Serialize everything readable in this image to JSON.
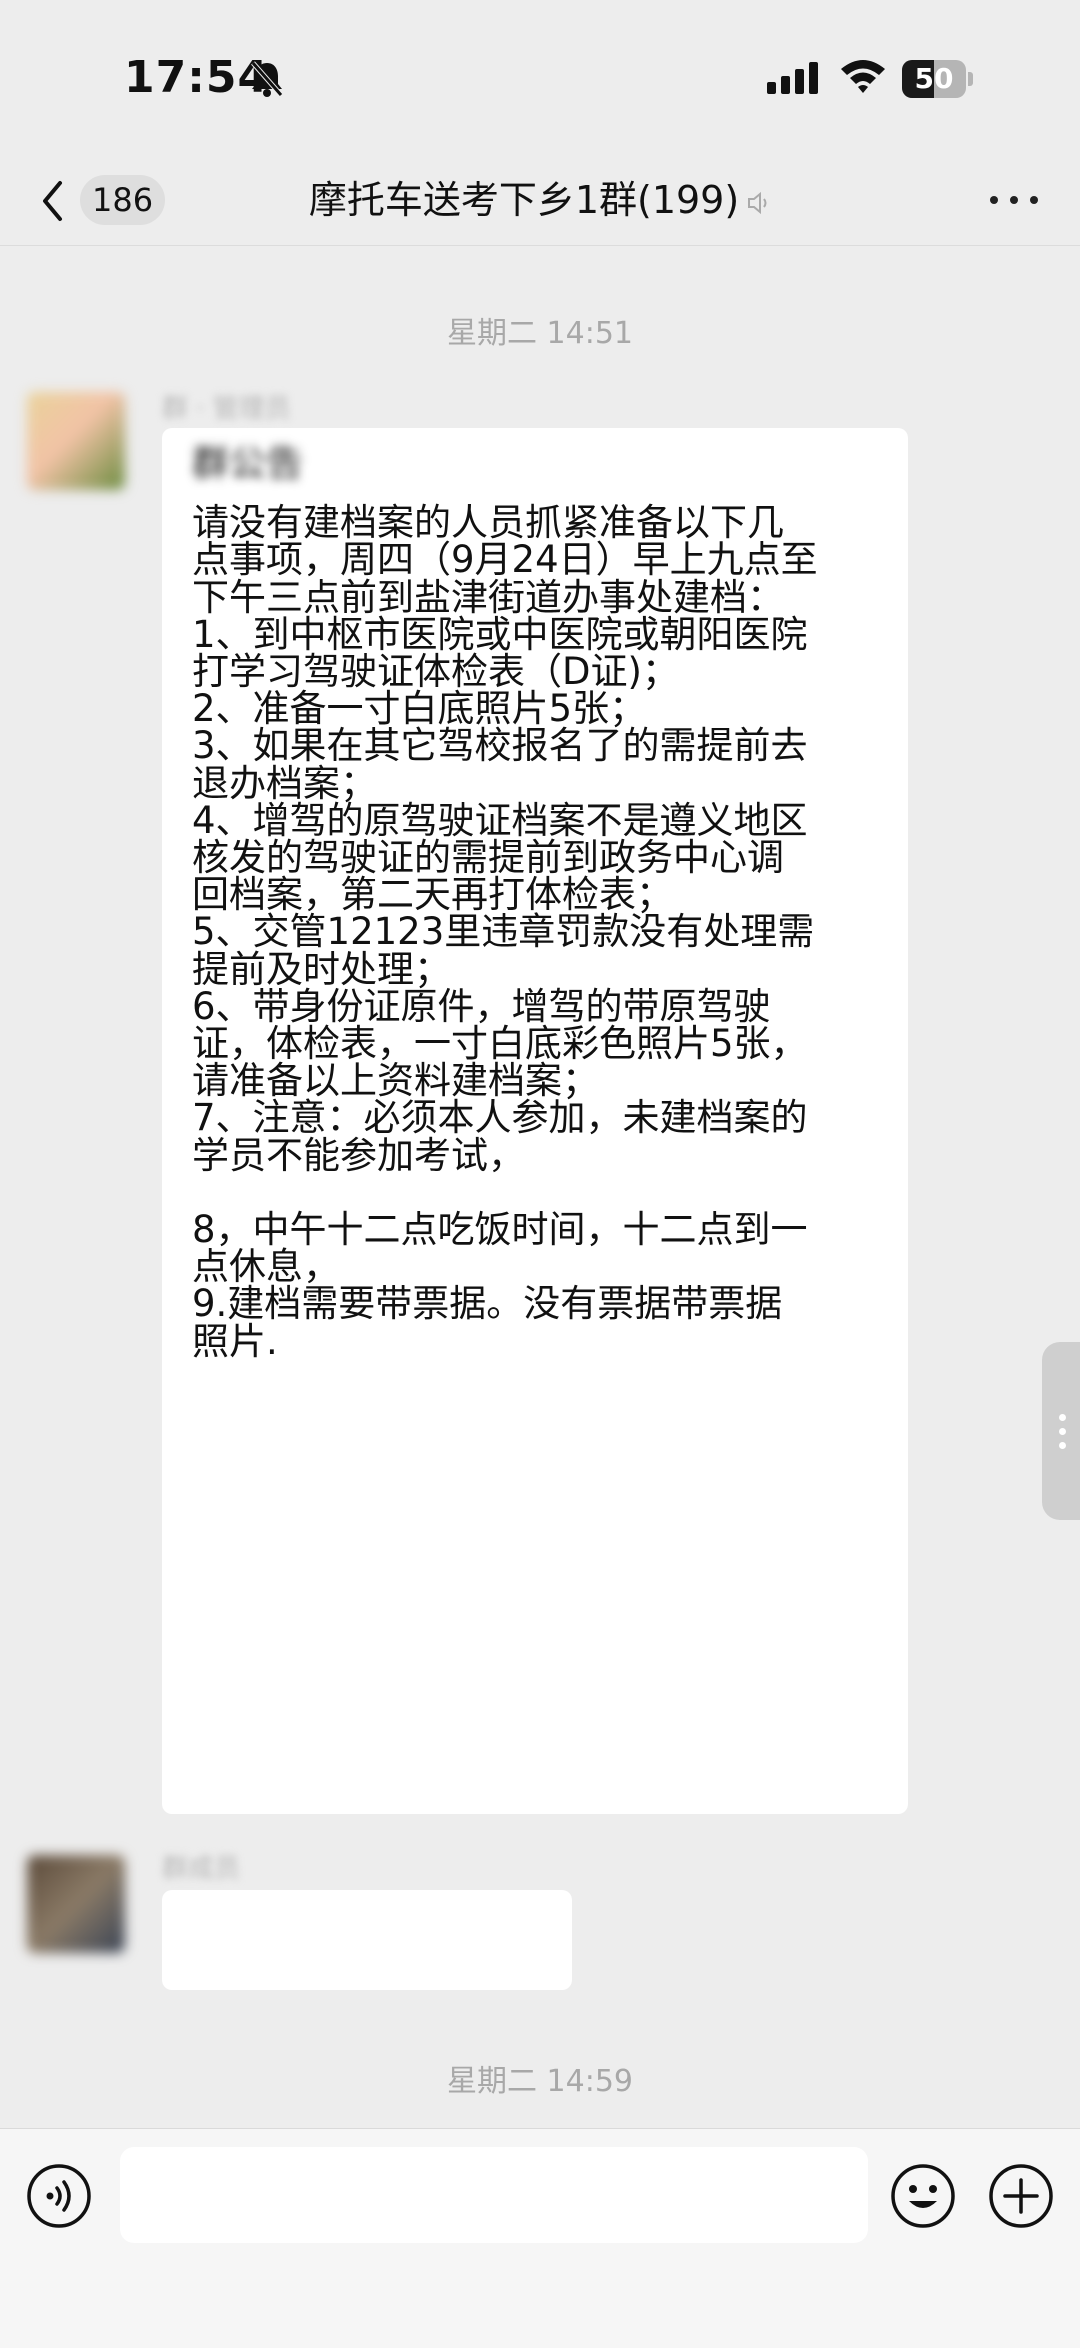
{
  "status_bar": {
    "time": "17:54",
    "battery_level": "50",
    "icons": [
      "bell-muted-icon",
      "signal-icon",
      "wifi-icon",
      "battery-icon"
    ]
  },
  "header": {
    "back_count": "186",
    "title": "摩托车送考下乡1群(199)",
    "icons": [
      "chevron-left-icon",
      "muted-icon",
      "more-icon"
    ]
  },
  "chat": {
    "timestamp_1": "星期二 14:51",
    "message_1": {
      "sender": "",
      "lines": [
        "群公告",
        "请没有建档案的人员抓紧准备以下几",
        "点事项，周四（9月24日）早上九点至",
        "下午三点前到盐津街道办事处建档：",
        "1、到中枢市医院或中医院或朝阳医院",
        "打学习驾驶证体检表（D证)；",
        "2、准备一寸白底照片5张；",
        "3、如果在其它驾校报名了的需提前去",
        "退办档案；",
        "4、增驾的原驾驶证档案不是遵义地区",
        "核发的驾驶证的需提前到政务中心调",
        "回档案，第二天再打体检表；",
        "5、交管12123里违章罚款没有处理需",
        "提前及时处理；",
        "6、带身份证原件，增驾的带原驾驶",
        "证，体检表，一寸白底彩色照片5张，",
        "请准备以上资料建档案；",
        "7、注意：必须本人参加，未建档案的",
        "学员不能参加考试，",
        "",
        "8，中午十二点吃饭时间，十二点到一",
        "点休息，",
        "9.建档需要带票据。没有票据带票据",
        "照片."
      ]
    },
    "message_2": {
      "text": ""
    },
    "timestamp_2": "星期二 14:59"
  },
  "input_bar": {
    "placeholder": "",
    "icons": [
      "voice-icon",
      "emoji-icon",
      "plus-icon"
    ]
  },
  "colors": {
    "background": "#ededed",
    "bubble": "#ffffff",
    "timestamp": "#a8a8a8"
  }
}
